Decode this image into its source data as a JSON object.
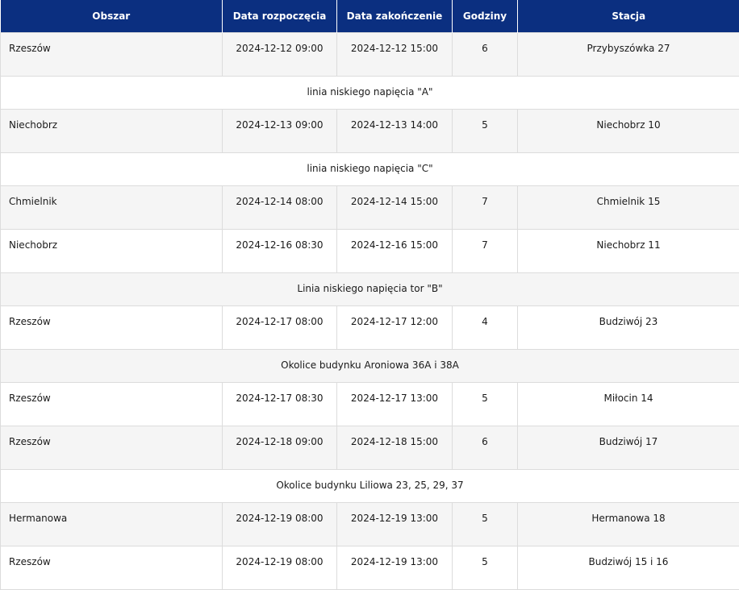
{
  "table": {
    "headers": [
      "Obszar",
      "Data rozpoczęcia",
      "Data zakończenie",
      "Godziny",
      "Stacja"
    ],
    "rows": [
      {
        "kind": "data",
        "shade": "grey",
        "cells": [
          "Rzeszów",
          "2024-12-12 09:00",
          "2024-12-12 15:00",
          "6",
          "Przybyszówka 27"
        ]
      },
      {
        "kind": "note",
        "shade": "white",
        "text": "linia niskiego napięcia \"A\""
      },
      {
        "kind": "data",
        "shade": "grey",
        "cells": [
          "Niechobrz",
          "2024-12-13 09:00",
          "2024-12-13 14:00",
          "5",
          "Niechobrz 10"
        ]
      },
      {
        "kind": "note",
        "shade": "white",
        "text": "linia niskiego napięcia \"C\""
      },
      {
        "kind": "data",
        "shade": "grey",
        "cells": [
          "Chmielnik",
          "2024-12-14 08:00",
          "2024-12-14 15:00",
          "7",
          "Chmielnik 15"
        ]
      },
      {
        "kind": "data",
        "shade": "white",
        "cells": [
          "Niechobrz",
          "2024-12-16 08:30",
          "2024-12-16 15:00",
          "7",
          "Niechobrz 11"
        ]
      },
      {
        "kind": "note",
        "shade": "grey",
        "text": "Linia niskiego napięcia tor \"B\""
      },
      {
        "kind": "data",
        "shade": "white",
        "cells": [
          "Rzeszów",
          "2024-12-17 08:00",
          "2024-12-17 12:00",
          "4",
          "Budziwój 23"
        ]
      },
      {
        "kind": "note",
        "shade": "grey",
        "text": "Okolice budynku Aroniowa 36A i 38A"
      },
      {
        "kind": "data",
        "shade": "white",
        "cells": [
          "Rzeszów",
          "2024-12-17 08:30",
          "2024-12-17 13:00",
          "5",
          "Miłocin 14"
        ]
      },
      {
        "kind": "data",
        "shade": "grey",
        "cells": [
          "Rzeszów",
          "2024-12-18 09:00",
          "2024-12-18 15:00",
          "6",
          "Budziwój 17"
        ]
      },
      {
        "kind": "note",
        "shade": "white",
        "text": "Okolice budynku Liliowa 23, 25, 29, 37"
      },
      {
        "kind": "data",
        "shade": "grey",
        "cells": [
          "Hermanowa",
          "2024-12-19 08:00",
          "2024-12-19 13:00",
          "5",
          "Hermanowa 18"
        ]
      },
      {
        "kind": "data",
        "shade": "white",
        "cells": [
          "Rzeszów",
          "2024-12-19 08:00",
          "2024-12-19 13:00",
          "5",
          "Budziwój 15 i 16"
        ]
      }
    ]
  },
  "colors": {
    "header_bg": "#0b2f80",
    "header_text": "#ffffff",
    "row_grey": "#f5f5f5",
    "row_white": "#ffffff",
    "border": "#dcdcdc"
  }
}
